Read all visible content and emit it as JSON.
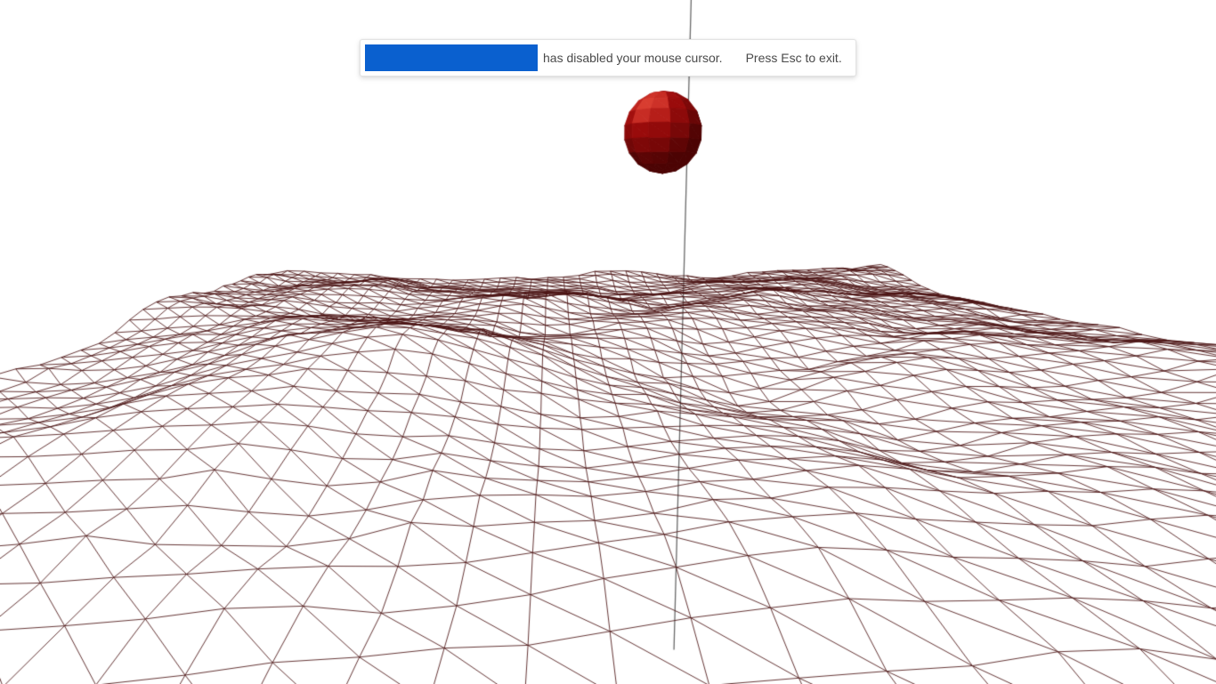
{
  "banner": {
    "message_text": "has disabled your mouse cursor.",
    "exit_text": "Press Esc to exit."
  },
  "scene": {
    "background": "#ffffff",
    "terrain_wire_color": "#4a1313",
    "grid_line_color": "#6a6a6a",
    "sphere_color": "#b40e0e",
    "sphere_shade_color": "#2a0000",
    "sphere_highlight_color": "#e24a3a",
    "terrain": {
      "n": 40,
      "size": 26,
      "amp": 1.15,
      "seed": 12
    },
    "camera": {
      "pos": [
        0.6,
        3.6,
        14.0
      ],
      "look": [
        2.0,
        -0.4,
        -3.0
      ],
      "fov_deg": 55
    },
    "sphere": {
      "center": [
        3.3,
        4.9,
        -2.5
      ],
      "radius": 0.95,
      "lat": 9,
      "lon": 12
    },
    "guides": [
      {
        "a": [
          4.0,
          -10,
          -3.0
        ],
        "b": [
          4.0,
          20,
          -3.0
        ]
      },
      {
        "a": [
          14.5,
          -10,
          4.0
        ],
        "b": [
          14.5,
          20,
          4.0
        ]
      },
      {
        "a": [
          -6.5,
          -10,
          14.0
        ],
        "b": [
          -6.5,
          20,
          14.0
        ]
      }
    ]
  }
}
